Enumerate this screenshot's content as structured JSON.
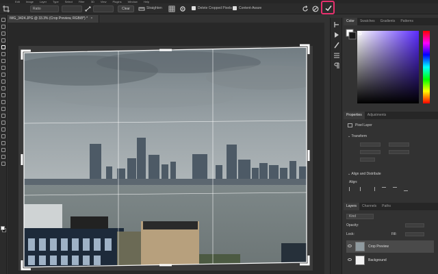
{
  "app": {
    "menu_items": [
      "Edit",
      "Image",
      "Layer",
      "Type",
      "Select",
      "Filter",
      "3D",
      "View",
      "Plugins",
      "Window",
      "Help"
    ]
  },
  "options_bar": {
    "tool_icon": "crop-icon",
    "ratio_value": "Ratio",
    "clear_label": "Clear",
    "straighten_label": "Straighten",
    "delete_cropped_label": "Delete Cropped Pixels",
    "content_aware_label": "Content-Aware",
    "reset_icon": "reset-icon",
    "cancel_icon": "cancel-icon",
    "commit_icon": "checkmark-icon",
    "accent_color": "#e8306e"
  },
  "document": {
    "tab_title": "IMG_3424.JPG @ 33.3% (Crop Preview, RGB/8*) *",
    "tab_close": "×"
  },
  "panels": {
    "color": {
      "tabs": [
        "Color",
        "Swatches",
        "Gradients",
        "Patterns"
      ],
      "active_tab": "Color"
    },
    "properties": {
      "tabs": [
        "Properties",
        "Adjustments"
      ],
      "active_tab": "Properties",
      "layer_type": "Pixel Layer",
      "sections": [
        "Transform",
        "Align and Distribute"
      ],
      "align_label": "Align:"
    },
    "layers": {
      "tabs": [
        "Layers",
        "Channels",
        "Paths"
      ],
      "active_tab": "Layers",
      "opacity_label": "Opacity:",
      "fill_label": "Fill:",
      "lock_label": "Lock:",
      "kind_label": "Kind",
      "layers": [
        {
          "name": "Crop Preview",
          "selected": true
        },
        {
          "name": "Background",
          "selected": false
        }
      ]
    }
  },
  "colors": {
    "app_background": "#323232",
    "panel_background": "#323232",
    "commit_highlight": "#e8306e"
  }
}
